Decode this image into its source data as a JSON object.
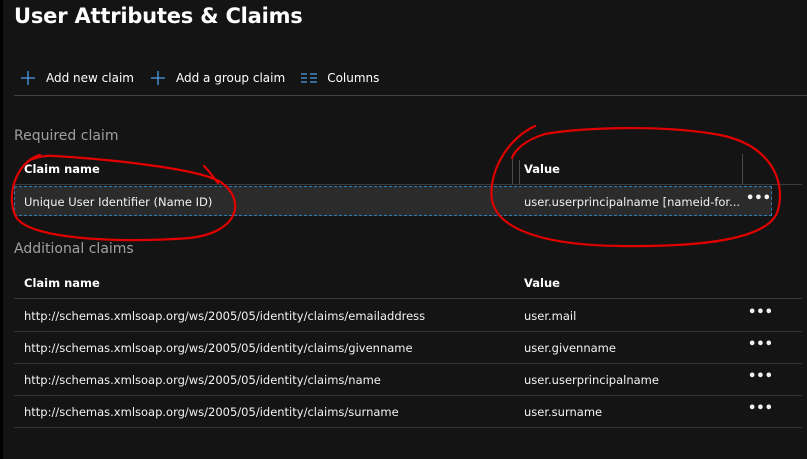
{
  "page": {
    "title": "User Attributes & Claims"
  },
  "toolbar": {
    "add_new_claim": "Add new claim",
    "add_group_claim": "Add a group claim",
    "columns": "Columns"
  },
  "required": {
    "section_title": "Required claim",
    "col_claim_name": "Claim name",
    "col_value": "Value",
    "row": {
      "name": "Unique User Identifier (Name ID)",
      "value": "user.userprincipalname [nameid-for...",
      "more": "•••"
    }
  },
  "additional": {
    "section_title": "Additional claims",
    "col_claim_name": "Claim name",
    "col_value": "Value",
    "rows": [
      {
        "name": "http://schemas.xmlsoap.org/ws/2005/05/identity/claims/emailaddress",
        "value": "user.mail",
        "more": "•••"
      },
      {
        "name": "http://schemas.xmlsoap.org/ws/2005/05/identity/claims/givenname",
        "value": "user.givenname",
        "more": "•••"
      },
      {
        "name": "http://schemas.xmlsoap.org/ws/2005/05/identity/claims/name",
        "value": "user.userprincipalname",
        "more": "•••"
      },
      {
        "name": "http://schemas.xmlsoap.org/ws/2005/05/identity/claims/surname",
        "value": "user.surname",
        "more": "•••"
      }
    ]
  },
  "colors": {
    "accent": "#4ea1e4",
    "annotation": "#e00000",
    "background": "#141414"
  },
  "icons": {
    "add": "plus-icon",
    "columns": "columns-icon",
    "more": "more-horizontal-icon"
  }
}
